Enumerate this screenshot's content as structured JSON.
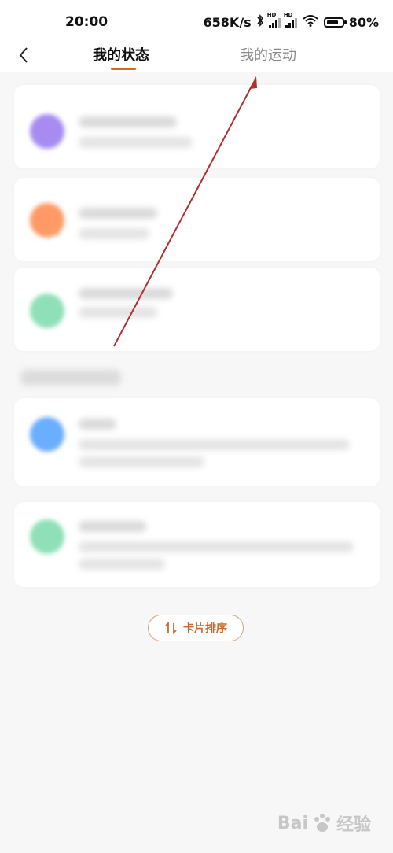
{
  "status_bar": {
    "time": "20:00",
    "network_speed": "658K/s",
    "battery_percent": "80%",
    "battery_level": 0.8,
    "icons": [
      "bluetooth-icon",
      "hd-signal-icon",
      "hd-signal-icon",
      "wifi-icon",
      "battery-icon"
    ]
  },
  "nav": {
    "back_icon": "chevron-left-icon",
    "tabs": [
      {
        "label": "我的状态",
        "active": true
      },
      {
        "label": "我的运动",
        "active": false
      }
    ],
    "accent_color": "#d9651f"
  },
  "cards": [
    {
      "dot_color": "#a78bf0"
    },
    {
      "dot_color": "#ff9a66"
    },
    {
      "dot_color": "#8fe0b8"
    },
    {
      "dot_color": "#6aaeff"
    },
    {
      "dot_color": "#8fe0b8"
    }
  ],
  "sort_button": {
    "icon": "sort-icon",
    "label": "卡片排序",
    "color": "#c8692b"
  },
  "annotation": {
    "arrow_color": "#b03030"
  },
  "watermark": {
    "text": "Bai",
    "suffix": "经验"
  }
}
